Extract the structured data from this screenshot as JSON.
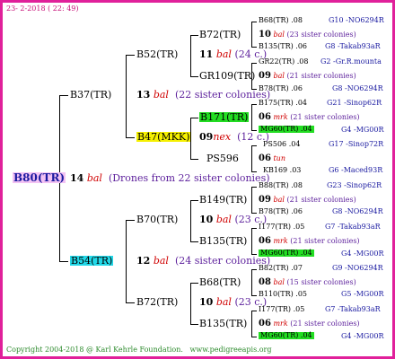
{
  "header": {
    "date": "23-  2-2018 ( 22: 49)"
  },
  "footer": {
    "copyright": "Copyright 2004-2018 @ Karl Kehrle Foundation.",
    "site": "www.pedigreeapis.org"
  },
  "root": {
    "id": "B80(TR)",
    "num": "14",
    "bal": "bal",
    "note": "(Drones from 22 sister colonies)"
  },
  "gen1": [
    {
      "id": "B37(TR)",
      "num": "13",
      "bal": "bal",
      "note": "(22 sister colonies)"
    },
    {
      "id": "B54(TR)",
      "num": "12",
      "bal": "bal",
      "note": "(24 sister colonies)"
    }
  ],
  "gen2": [
    {
      "id": "B52(TR)",
      "num": "11",
      "bal": "bal",
      "note": "(24 c.)"
    },
    {
      "id": "B47(MKK)",
      "num": "09",
      "bal": "nex",
      "note": "(12 c.)"
    },
    {
      "id": "B70(TR)",
      "num": "10",
      "bal": "bal",
      "note": "(23 c.)"
    },
    {
      "id": "B72(TR)",
      "num": "10",
      "bal": "bal",
      "note": "(23 c.)"
    }
  ],
  "gen3": [
    {
      "id": "B72(TR)"
    },
    {
      "id": "GR109(TR)"
    },
    {
      "id": "B171(TR)"
    },
    {
      "id": "PS596"
    },
    {
      "id": "B149(TR)"
    },
    {
      "id": "B135(TR)"
    },
    {
      "id": "B68(TR)"
    },
    {
      "id": "B135(TR)"
    }
  ],
  "gen4": [
    {
      "id": "B68(TR)",
      "yr": ".08",
      "ref": "G10 -NO6294R"
    },
    {
      "num": "10",
      "bal": "bal",
      "note": "(23 sister colonies)"
    },
    {
      "id": "B135(TR)",
      "yr": ".06",
      "ref": "G8 -Takab93aR"
    },
    {
      "id": "GR22(TR)",
      "yr": ".08",
      "ref": "G2 -Gr.R.mounta"
    },
    {
      "num": "09",
      "bal": "bal",
      "note": "(21 sister colonies)"
    },
    {
      "id": "B78(TR)",
      "yr": ".06",
      "ref": "G8 -NO6294R"
    },
    {
      "id": "B175(TR)",
      "yr": ".04",
      "ref": "G21 -Sinop62R"
    },
    {
      "num": "06",
      "bal": "mrk",
      "note": "(21 sister colonies)"
    },
    {
      "id": "MG60(TR)",
      "yr": ".04",
      "ref": "G4 -MG00R"
    },
    {
      "id": "PS506",
      "yr": ".04",
      "ref": "G17 -Sinop72R"
    },
    {
      "num": "06",
      "bal": "tun",
      "note": ""
    },
    {
      "id": "KB169",
      "yr": ".03",
      "ref": "G6 -Maced93R"
    },
    {
      "id": "B88(TR)",
      "yr": ".08",
      "ref": "G23 -Sinop62R"
    },
    {
      "num": "09",
      "bal": "bal",
      "note": "(21 sister colonies)"
    },
    {
      "id": "B78(TR)",
      "yr": ".06",
      "ref": "G8 -NO6294R"
    },
    {
      "id": "I177(TR)",
      "yr": ".05",
      "ref": "G7 -Takab93aR"
    },
    {
      "num": "06",
      "bal": "mrk",
      "note": "(21 sister colonies)"
    },
    {
      "id": "MG60(TR)",
      "yr": ".04",
      "ref": "G4 -MG00R"
    },
    {
      "id": "B82(TR)",
      "yr": ".07",
      "ref": "G9 -NO6294R"
    },
    {
      "num": "08",
      "bal": "bal",
      "note": "(15 sister colonies)"
    },
    {
      "id": "B110(TR)",
      "yr": ".05",
      "ref": "G5 -MG00R"
    },
    {
      "id": "I177(TR)",
      "yr": ".05",
      "ref": "G7 -Takab93aR"
    },
    {
      "num": "06",
      "bal": "mrk",
      "note": "(21 sister colonies)"
    },
    {
      "id": "MG60(TR)",
      "yr": ".04",
      "ref": "G4 -MG00R"
    }
  ]
}
